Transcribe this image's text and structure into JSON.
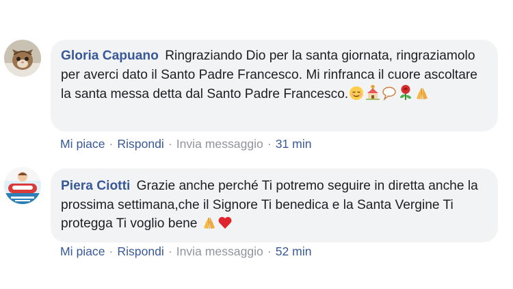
{
  "comments": [
    {
      "author": "Gloria Capuano",
      "text": "Ringraziando Dio per la santa giornata, ringraziamolo per averci dato il Santo Padre Francesco. Mi rinfranca il cuore ascoltare la santa messa detta dal Santo Padre Francesco.",
      "emojis": [
        "relieved-face-emoji",
        "church-emoji",
        "speech-bubble-emoji",
        "rose-emoji",
        "folded-hands-emoji"
      ],
      "actions": {
        "like": "Mi piace",
        "reply": "Rispondi",
        "message": "Invia messaggio",
        "time": "31 min"
      }
    },
    {
      "author": "Piera Ciotti",
      "text": "Grazie anche perché Ti potremo seguire in diretta anche la prossima settimana,che il Signore Ti benedica e la Santa Vergine Ti protegga Ti voglio bene",
      "emojis": [
        "folded-hands-emoji",
        "red-heart-emoji"
      ],
      "actions": {
        "like": "Mi piace",
        "reply": "Rispondi",
        "message": "Invia messaggio",
        "time": "52 min"
      }
    }
  ],
  "separator": "·",
  "colors": {
    "author": "#385898",
    "link": "#385898",
    "muted": "#90949c",
    "bubble": "#f2f3f5",
    "text": "#1c1e21"
  }
}
